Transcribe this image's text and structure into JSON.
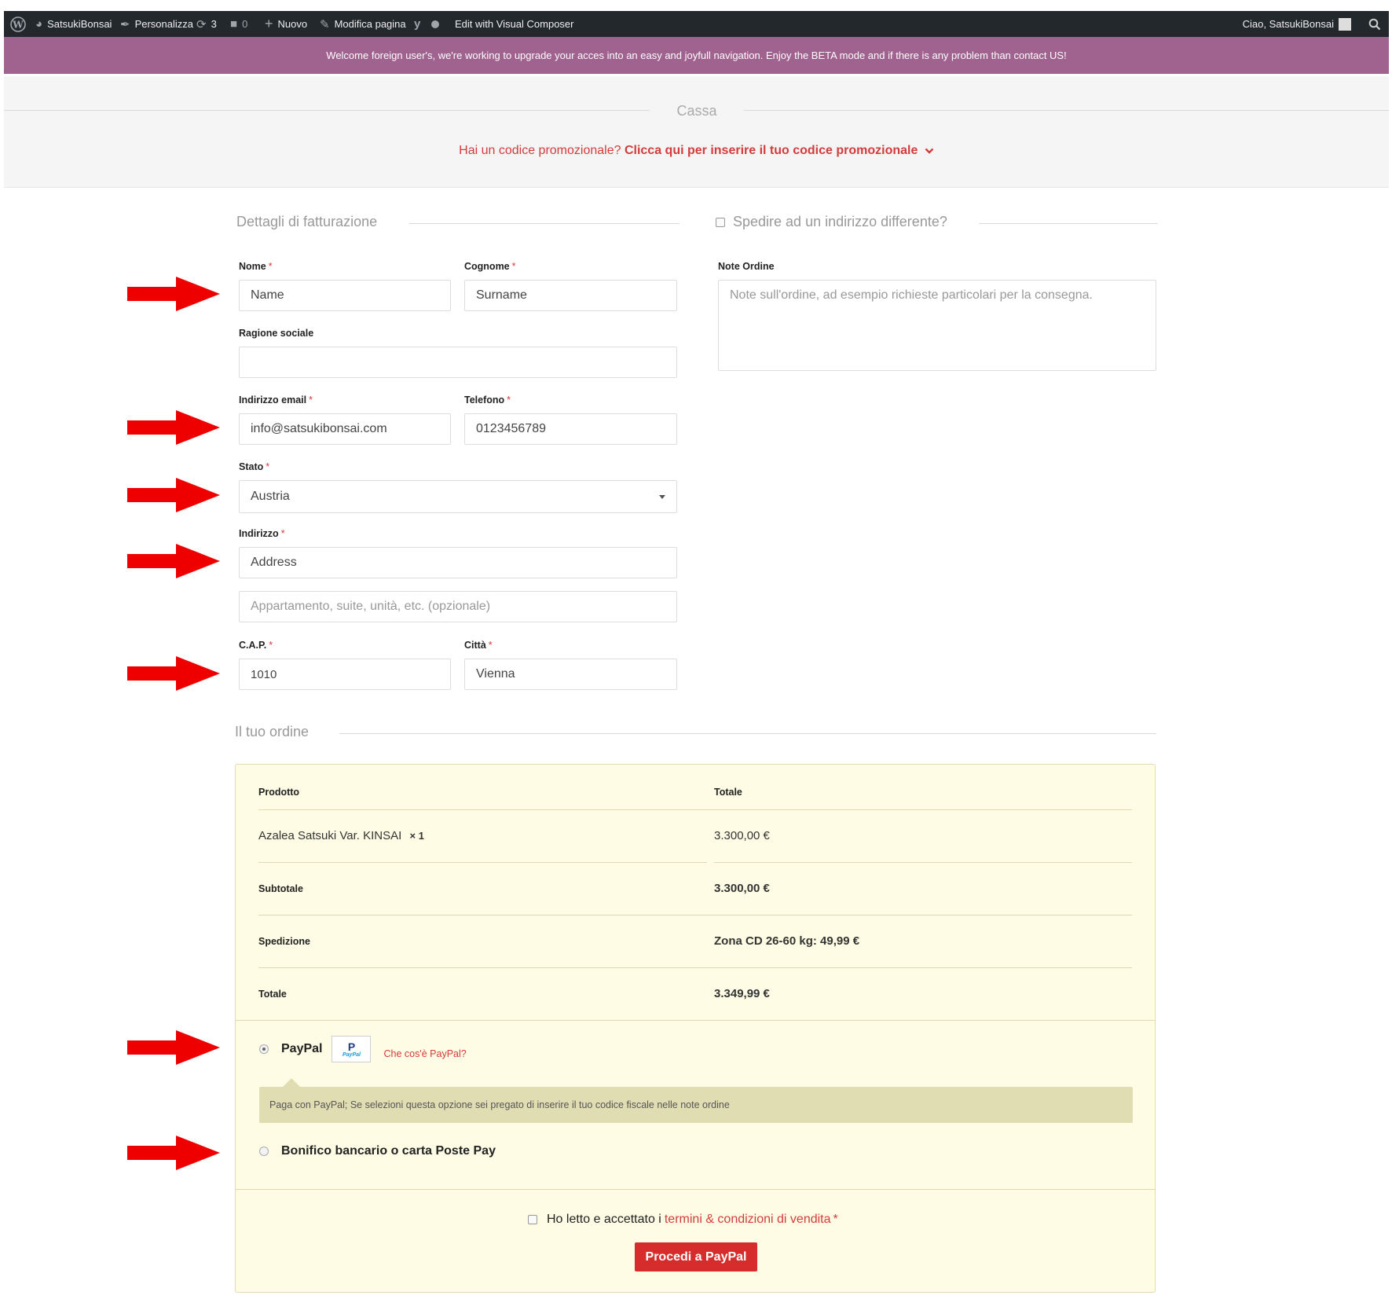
{
  "admin_bar": {
    "site_name": "SatsukiBonsai",
    "customize": "Personalizza",
    "updates_count": "3",
    "comments_count": "0",
    "new": "Nuovo",
    "edit_page": "Modifica pagina",
    "visual_composer": "Edit with Visual Composer",
    "greeting": "Ciao, SatsukiBonsai"
  },
  "notice": "Welcome foreign user's, we're working to upgrade your acces into an easy and joyfull navigation. Enjoy the BETA mode and if there is any problem than contact US!",
  "page_title": "Cassa",
  "promo": {
    "question": "Hai un codice promozionale?",
    "link": "Clicca qui per inserire il tuo codice promozionale"
  },
  "billing": {
    "title": "Dettagli di fatturazione",
    "first_name_label": "Nome",
    "first_name_value": "Name",
    "last_name_label": "Cognome",
    "last_name_value": "Surname",
    "company_label": "Ragione sociale",
    "company_value": "",
    "email_label": "Indirizzo email",
    "email_value": "info@satsukibonsai.com",
    "phone_label": "Telefono",
    "phone_value": "0123456789",
    "country_label": "Stato",
    "country_value": "Austria",
    "address_label": "Indirizzo",
    "address_value": "Address",
    "address2_placeholder": "Appartamento, suite, unità, etc. (opzionale)",
    "postcode_label": "C.A.P.",
    "postcode_value": "1010",
    "city_label": "Città",
    "city_value": "Vienna",
    "required_mark": "*"
  },
  "shipping": {
    "toggle_label": "Spedire ad un indirizzo differente?",
    "notes_label": "Note Ordine",
    "notes_placeholder": "Note sull'ordine, ad esempio richieste particolari per la consegna."
  },
  "order": {
    "title": "Il tuo ordine",
    "col_product": "Prodotto",
    "col_total": "Totale",
    "product_name": "Azalea Satsuki Var. KINSAI",
    "product_qty": "× 1",
    "product_total": "3.300,00 €",
    "subtotal_label": "Subtotale",
    "subtotal_value": "3.300,00 €",
    "shipping_label": "Spedizione",
    "shipping_value": "Zona CD 26-60 kg: 49,99 €",
    "total_label": "Totale",
    "total_value": "3.349,99 €"
  },
  "payment": {
    "paypal_label": "PayPal",
    "paypal_logo_text": "PayPal",
    "paypal_what": "Che cos'è PayPal?",
    "paypal_desc": "Paga con PayPal; Se selezioni questa opzione sei pregato di inserire il tuo codice fiscale nelle note ordine",
    "bank_label": "Bonifico bancario o carta Poste Pay",
    "terms_prefix": "Ho letto e accettato i",
    "terms_link": "termini & condizioni di vendita",
    "proceed_button": "Procedi a PayPal"
  },
  "colors": {
    "accent": "#d43b3b",
    "notice_bg": "#a0628f",
    "adminbar_bg": "#23282d",
    "order_bg": "#fefce4",
    "arrow": "#ee0000"
  }
}
